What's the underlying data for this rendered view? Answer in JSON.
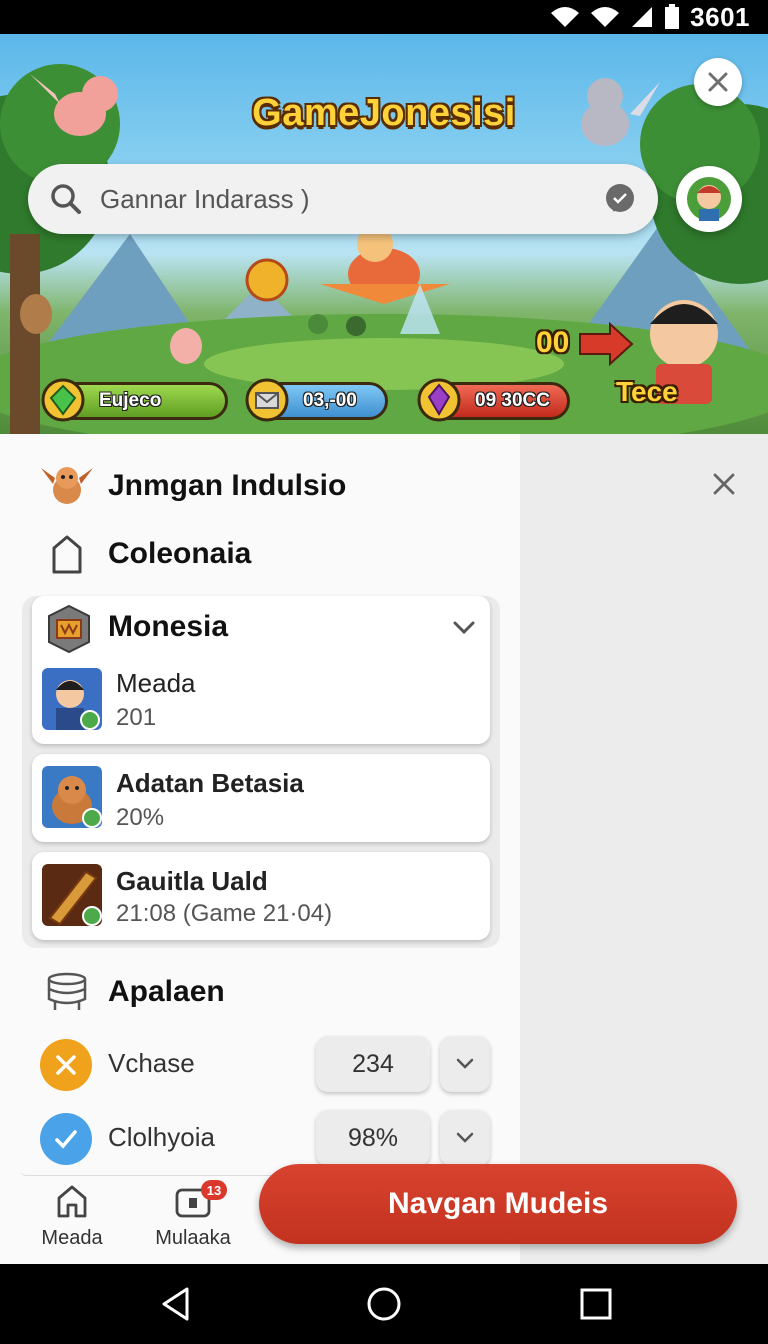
{
  "status_bar": {
    "time": "3601"
  },
  "hero": {
    "title": "GameJonesisi",
    "search": {
      "placeholder": "Gannar Indarass )"
    },
    "resources": [
      {
        "label": "Eujeco",
        "color": "#7cc23a"
      },
      {
        "label": "03,-00",
        "color": "#5aa8e6"
      },
      {
        "label": "09 30CC",
        "color": "#e04a38"
      }
    ],
    "score": "00",
    "tag": "Tece"
  },
  "menu": {
    "header": "Jnmgan Indulsio",
    "collections": "Coleonaia",
    "group": {
      "title": "Monesia",
      "items": [
        {
          "title": "Meada",
          "subtitle": "201"
        },
        {
          "title": "Adatan Betasia",
          "subtitle": "20%"
        },
        {
          "title": "Gauitla Uald",
          "subtitle": "21:08 (Game 21·04)"
        }
      ]
    },
    "stats_header": "Apalaen",
    "stats": [
      {
        "label": "Vchase",
        "value": "234",
        "color": "#f0a21c"
      },
      {
        "label": "Clolhyoia",
        "value": "98%",
        "color": "#4aa3e8"
      }
    ]
  },
  "tabs": [
    {
      "label": "Meada"
    },
    {
      "label": "Mulaaka",
      "badge": "13"
    }
  ],
  "cta": {
    "label": "Navgan Mudeis",
    "color": "#c9371f"
  }
}
